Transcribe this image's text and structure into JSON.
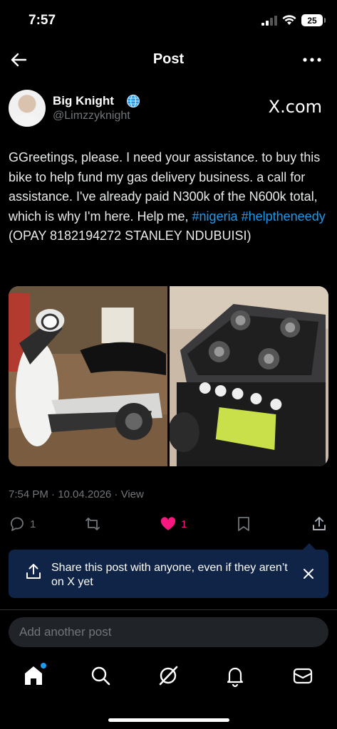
{
  "status": {
    "time": "7:57",
    "battery": "25"
  },
  "nav": {
    "title": "Post",
    "back_icon": "arrow-left-icon",
    "more_icon": "more-horizontal-icon"
  },
  "author": {
    "name": "Big Knight",
    "handle": "@Limzzyknight",
    "badge": "globe-icon",
    "source_label": "X.com"
  },
  "post": {
    "text_before": "GGreetings, please. I need your assistance. to buy this bike to help fund my gas delivery business. a call for assistance. I've already paid N300k of the N600k total, which is why I'm here. Help me, ",
    "hashtag_1": "#nigeria",
    "hashtag_2": "#helptheneedy",
    "text_after": " (OPAY 8182194272 STANLEY NDUBUISI)",
    "timestamp": "7:54 PM · 10.04.2026 · View"
  },
  "actions": {
    "replies": "1",
    "reposts": "",
    "likes": "1",
    "like_color": "#f91880"
  },
  "share_card": {
    "text": "Share this post with anyone, even if they aren’t on X yet",
    "bg_color": "#0f2446"
  },
  "reply_box": {
    "placeholder": "Add another post"
  },
  "tabs": [
    "home-icon",
    "search-icon",
    "grok-icon",
    "notifications-icon",
    "messages-icon"
  ],
  "colors": {
    "accent": "#1d9bf0",
    "muted": "#71767b",
    "background": "#000000"
  }
}
